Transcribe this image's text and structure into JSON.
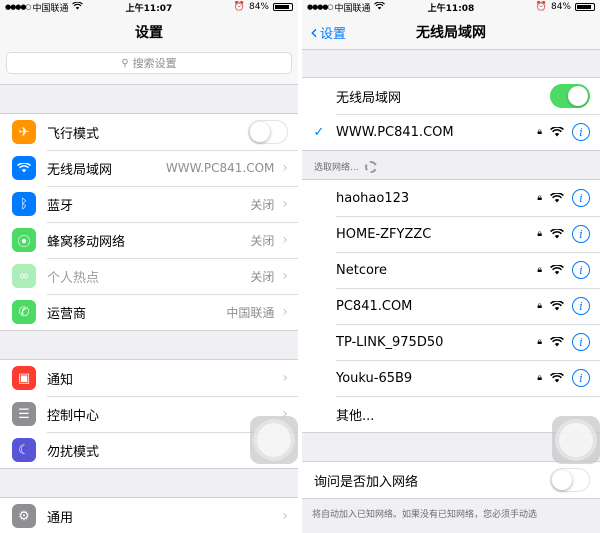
{
  "left": {
    "status": {
      "carrier": "中国联通",
      "time": "上午11:07",
      "battery": "84%"
    },
    "nav_title": "设置",
    "search_placeholder": "搜索设置",
    "group1": [
      {
        "label": "飞行模式",
        "icon": "airplane-icon",
        "color": "#ff9500",
        "toggle": false
      },
      {
        "label": "无线局域网",
        "icon": "wifi-icon",
        "color": "#007aff",
        "value": "WWW.PC841.COM"
      },
      {
        "label": "蓝牙",
        "icon": "bluetooth-icon",
        "color": "#007aff",
        "value": "关闭"
      },
      {
        "label": "蜂窝移动网络",
        "icon": "cellular-icon",
        "color": "#4cd964",
        "value": "关闭"
      },
      {
        "label": "个人热点",
        "icon": "hotspot-icon",
        "color": "#4cd964",
        "value": "关闭",
        "dim": true
      },
      {
        "label": "运营商",
        "icon": "phone-icon",
        "color": "#4cd964",
        "value": "中国联通"
      }
    ],
    "group2": [
      {
        "label": "通知",
        "icon": "notifications-icon",
        "color": "#ff3b30"
      },
      {
        "label": "控制中心",
        "icon": "control-center-icon",
        "color": "#8e8e93"
      },
      {
        "label": "勿扰模式",
        "icon": "moon-icon",
        "color": "#5856d6"
      }
    ],
    "group3": [
      {
        "label": "通用",
        "icon": "gear-icon",
        "color": "#8e8e93"
      }
    ]
  },
  "right": {
    "status": {
      "carrier": "中国联通",
      "time": "上午11:08",
      "battery": "84%"
    },
    "back_label": "设置",
    "nav_title": "无线局域网",
    "wifi_label": "无线局域网",
    "wifi_on": true,
    "connected": "WWW.PC841.COM",
    "choose_label": "选取网络...",
    "networks": [
      "haohao123",
      "HOME-ZFYZZC",
      "Netcore",
      "PC841.COM",
      "TP-LINK_975D50",
      "Youku-65B9"
    ],
    "other_label": "其他...",
    "ask_label": "询问是否加入网络",
    "ask_on": false,
    "footnote": "将自动加入已知网络。如果没有已知网络，您必须手动选"
  }
}
